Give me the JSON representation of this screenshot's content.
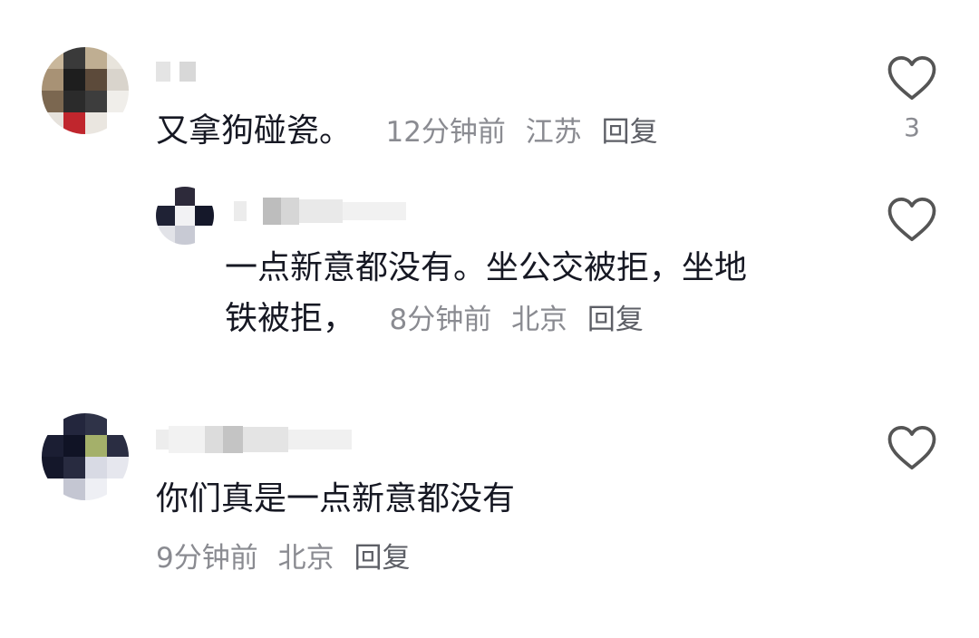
{
  "comments": [
    {
      "text": "又拿狗碰瓷。",
      "time": "12分钟前",
      "location": "江苏",
      "reply_label": "回复",
      "like_count": "3"
    },
    {
      "text_line1": "一点新意都没有。坐公交被拒，坐地",
      "text_line2": "铁被拒，",
      "time": "8分钟前",
      "location": "北京",
      "reply_label": "回复"
    },
    {
      "text": "你们真是一点新意都没有",
      "time": "9分钟前",
      "location": "北京",
      "reply_label": "回复"
    }
  ],
  "icons": {
    "like": "heart-outline-icon"
  },
  "colors": {
    "text": "#161823",
    "meta": "#8a8b91",
    "icon": "#555555"
  }
}
